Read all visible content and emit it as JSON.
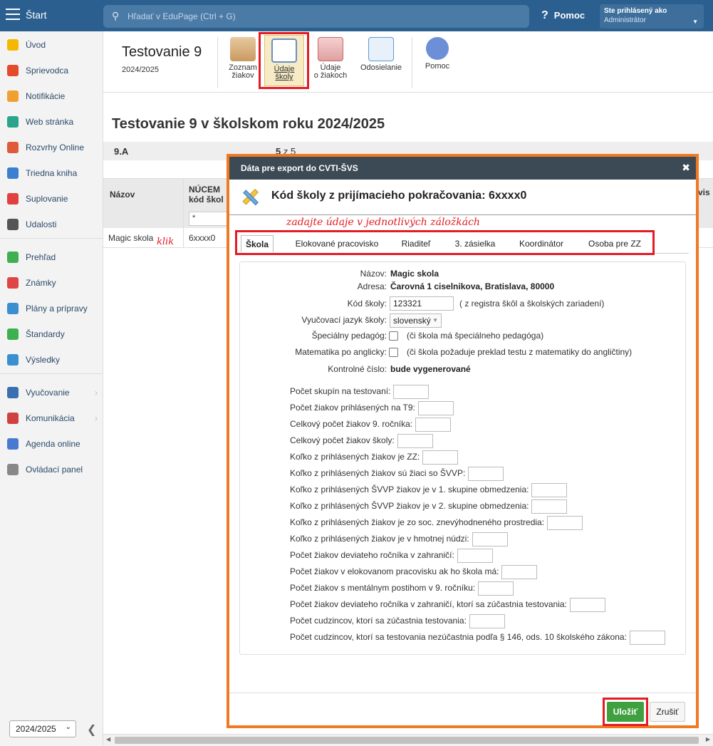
{
  "topbar": {
    "start": "Štart",
    "search_placeholder": "Hľadať v EduPage (Ctrl + G)",
    "help": "Pomoc",
    "user_line1": "Ste prihlásený ako",
    "user_line2": "Administrátor"
  },
  "sidebar": {
    "items": [
      {
        "label": "Úvod",
        "icon": "star-icon",
        "color": "#f5b800"
      },
      {
        "label": "Sprievodca",
        "icon": "wand-icon",
        "color": "#e34b2a"
      },
      {
        "label": "Notifikácie",
        "icon": "envelope-icon",
        "color": "#f0a030"
      },
      {
        "label": "Web stránka",
        "icon": "house-icon",
        "color": "#2aa58a"
      },
      {
        "label": "Rozvrhy Online",
        "icon": "grid-icon",
        "color": "#e05a3a"
      },
      {
        "label": "Triedna kniha",
        "icon": "book-icon",
        "color": "#3a7fd0"
      },
      {
        "label": "Suplovanie",
        "icon": "person-icon",
        "color": "#e04040"
      },
      {
        "label": "Udalosti",
        "icon": "calendar-icon",
        "color": "#555555"
      },
      {
        "label": "Prehľad",
        "icon": "check-icon",
        "color": "#3fb04f"
      },
      {
        "label": "Známky",
        "icon": "grade-icon",
        "color": "#e04545"
      },
      {
        "label": "Plány a prípravy",
        "icon": "briefcase-icon",
        "color": "#3a8fd0"
      },
      {
        "label": "Štandardy",
        "icon": "shield-icon",
        "color": "#3fb04f"
      },
      {
        "label": "Výsledky",
        "icon": "bar-chart-icon",
        "color": "#3a8fd0"
      },
      {
        "label": "Vyučovanie",
        "icon": "open-book-icon",
        "color": "#3a6fb0"
      },
      {
        "label": "Komunikácia",
        "icon": "chat-icon",
        "color": "#d04040"
      },
      {
        "label": "Agenda online",
        "icon": "pen-icon",
        "color": "#4a7ad0"
      },
      {
        "label": "Ovládací panel",
        "icon": "gear-icon",
        "color": "#888888"
      }
    ],
    "year": "2024/2025"
  },
  "header": {
    "title": "Testovanie 9",
    "year": "2024/2025",
    "toolbar": [
      {
        "label": "Zoznam\nžiakov"
      },
      {
        "label": "Údaje\nškoly"
      },
      {
        "label": "Údaje\no žiakoch"
      },
      {
        "label": "Odosielanie"
      },
      {
        "label": "Pomoc"
      }
    ]
  },
  "page": {
    "title": "Testovanie 9 v školskom roku 2024/2025",
    "class_name": "9.A",
    "class_count_bold": "5",
    "class_count_rest": "z 5",
    "col_name": "Názov",
    "col_nucem": "NÚCEM\nkód škol",
    "filter_value": "*",
    "row_name": "Magic skola",
    "row_code": "6xxxx0",
    "klik": "klik",
    "vis_hint": "vis"
  },
  "dialog": {
    "title": "Dáta pre export do CVTI-ŠVS",
    "heading": "Kód školy z prijímacieho pokračovania: 6xxxx0",
    "annotation": "zadajte údaje v jednotlivých záložkách",
    "tabs": [
      "Škola",
      "Elokované pracovisko",
      "Riaditeľ",
      "3. zásielka",
      "Koordinátor",
      "Osoba pre ZZ"
    ],
    "form": {
      "name_label": "Názov:",
      "name_value": "Magic skola",
      "address_label": "Adresa:",
      "address_value": "Čarovná 1 ciselnikova, Bratislava, 80000",
      "code_label": "Kód školy:",
      "code_value": "123321",
      "code_note": "( z registra škôl a školských zariadení)",
      "lang_label": "Vyučovací jazyk školy:",
      "lang_value": "slovenský",
      "special_label": "Špeciálny pedagóg:",
      "special_note": "(či škola má špeciálneho pedagóga)",
      "math_label": "Matematika po anglicky:",
      "math_note": "(či škola požaduje preklad testu z matematiky do angličtiny)",
      "control_label": "Kontrolné číslo:",
      "control_value": "bude vygenerované"
    },
    "rows": [
      "Počet skupín na testovaní:",
      "Počet žiakov prihlásených na T9:",
      "Celkový počet žiakov 9. ročníka:",
      "Celkový počet žiakov školy:",
      "Koľko z prihlásených žiakov je ZZ:",
      "Koľko z prihlásených žiakov sú žiaci so ŠVVP:",
      "Koľko z prihlásených ŠVVP žiakov je v 1. skupine obmedzenia:",
      "Koľko z prihlásených ŠVVP žiakov je v 2. skupine obmedzenia:",
      "Koľko z prihlásených žiakov je zo soc. znevýhodneného prostredia:",
      "Koľko z prihlásených žiakov je v hmotnej núdzi:",
      "Počet žiakov deviateho ročníka v zahraničí:",
      "Počet žiakov v elokovanom pracovisku ak ho škola má:",
      "Počet žiakov s mentálnym postihom v 9. ročníku:",
      "Počet žiakov deviateho ročníka v zahraničí, ktorí sa zúčastnia testovania:",
      "Počet cudzincov, ktorí sa zúčastnia testovania:",
      "Počet cudzincov, ktorí sa testovania nezúčastnia podľa § 146, ods. 10 školského zákona:"
    ],
    "save": "Uložiť",
    "cancel": "Zrušiť"
  }
}
